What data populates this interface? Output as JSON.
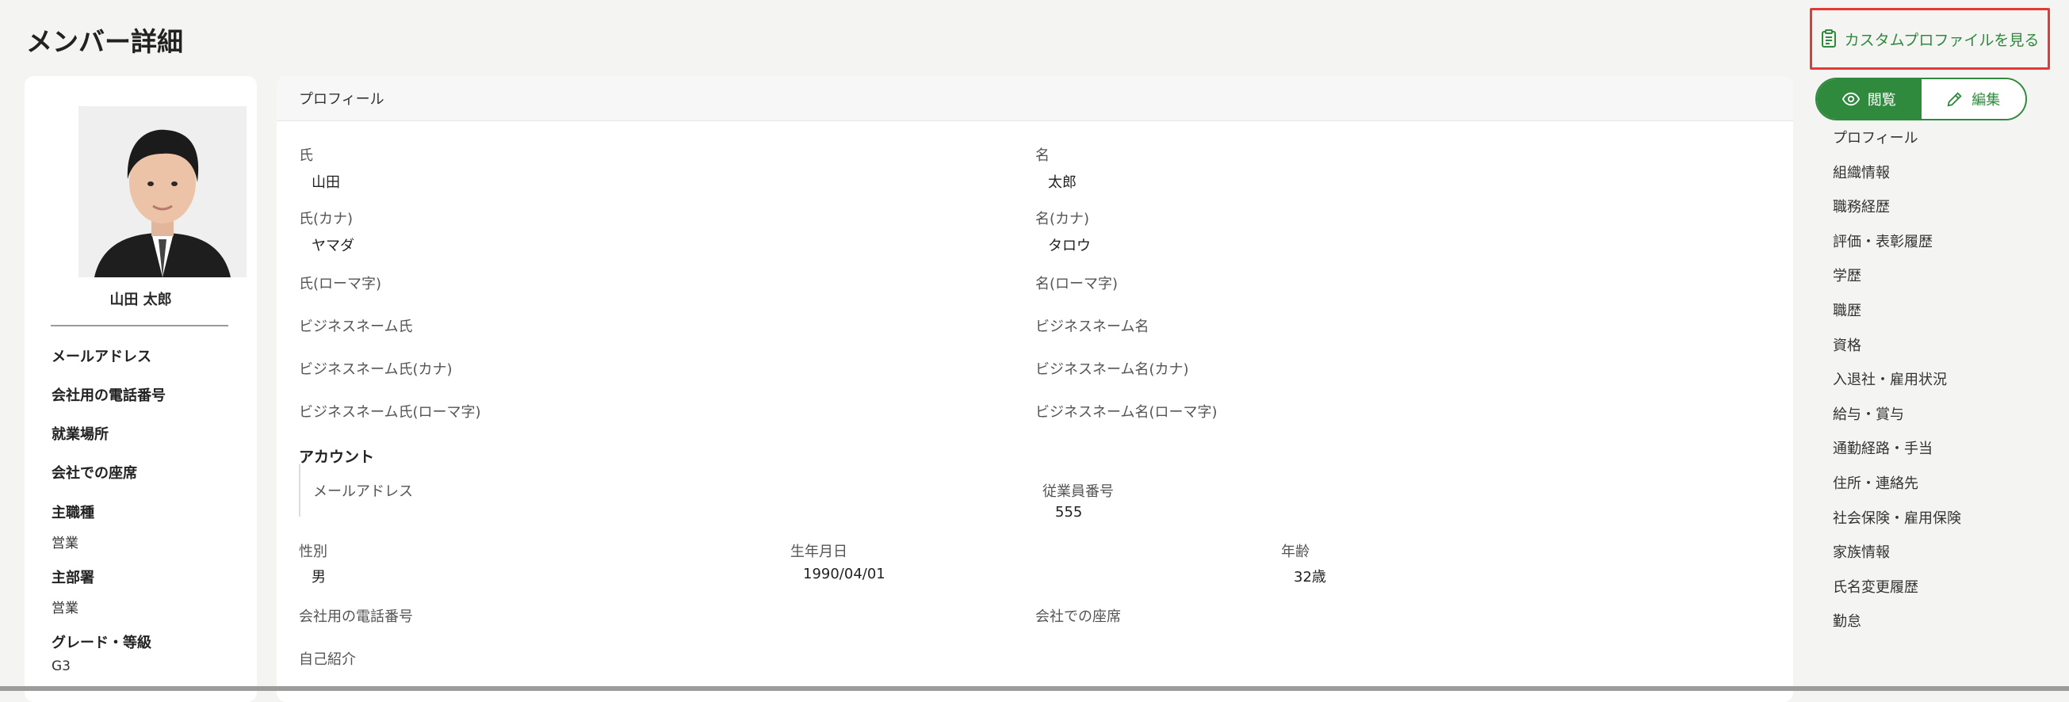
{
  "page": {
    "title": "メンバー詳細"
  },
  "header": {
    "custom_profile_button": "カスタムプロファイルを見る"
  },
  "member": {
    "name": "山田 太郎",
    "fields": [
      {
        "label": "メールアドレス",
        "value": ""
      },
      {
        "label": "会社用の電話番号",
        "value": ""
      },
      {
        "label": "就業場所",
        "value": ""
      },
      {
        "label": "会社での座席",
        "value": ""
      },
      {
        "label": "主職種",
        "value": "営業"
      },
      {
        "label": "主部署",
        "value": "営業"
      },
      {
        "label": "グレード・等級",
        "value": "G3"
      }
    ]
  },
  "profile": {
    "header": "プロフィール",
    "last_name": {
      "label": "氏",
      "value": "山田"
    },
    "first_name": {
      "label": "名",
      "value": "太郎"
    },
    "last_name_kana": {
      "label": "氏(カナ)",
      "value": "ヤマダ"
    },
    "first_name_kana": {
      "label": "名(カナ)",
      "value": "タロウ"
    },
    "last_name_roman": {
      "label": "氏(ローマ字)",
      "value": ""
    },
    "first_name_roman": {
      "label": "名(ローマ字)",
      "value": ""
    },
    "biz_last": {
      "label": "ビジネスネーム氏",
      "value": ""
    },
    "biz_first": {
      "label": "ビジネスネーム名",
      "value": ""
    },
    "biz_last_kana": {
      "label": "ビジネスネーム氏(カナ)",
      "value": ""
    },
    "biz_first_kana": {
      "label": "ビジネスネーム名(カナ)",
      "value": ""
    },
    "biz_last_roman": {
      "label": "ビジネスネーム氏(ローマ字)",
      "value": ""
    },
    "biz_first_roman": {
      "label": "ビジネスネーム名(ローマ字)",
      "value": ""
    },
    "account_title": "アカウント",
    "account_email": {
      "label": "メールアドレス",
      "value": ""
    },
    "employee_number": {
      "label": "従業員番号",
      "value": "555"
    },
    "gender": {
      "label": "性別",
      "value": "男"
    },
    "birthdate": {
      "label": "生年月日",
      "value": "1990/04/01"
    },
    "age": {
      "label": "年齢",
      "value": "32歳"
    },
    "company_phone": {
      "label": "会社用の電話番号",
      "value": ""
    },
    "company_seat": {
      "label": "会社での座席",
      "value": ""
    },
    "self_intro": {
      "label": "自己紹介",
      "value": ""
    }
  },
  "toggle": {
    "view": "閲覧",
    "edit": "編集",
    "active": "view"
  },
  "nav": [
    "プロフィール",
    "組織情報",
    "職務経歴",
    "評価・表彰履歴",
    "学歴",
    "職歴",
    "資格",
    "入退社・雇用状況",
    "給与・賞与",
    "通勤経路・手当",
    "住所・連絡先",
    "社会保険・雇用保険",
    "家族情報",
    "氏名変更履歴",
    "勤怠"
  ],
  "colors": {
    "accent": "#2f8a3d",
    "highlight": "#e53935"
  },
  "icons": {
    "custom_profile": "clipboard-icon",
    "view": "eye-icon",
    "edit": "pencil-icon"
  }
}
